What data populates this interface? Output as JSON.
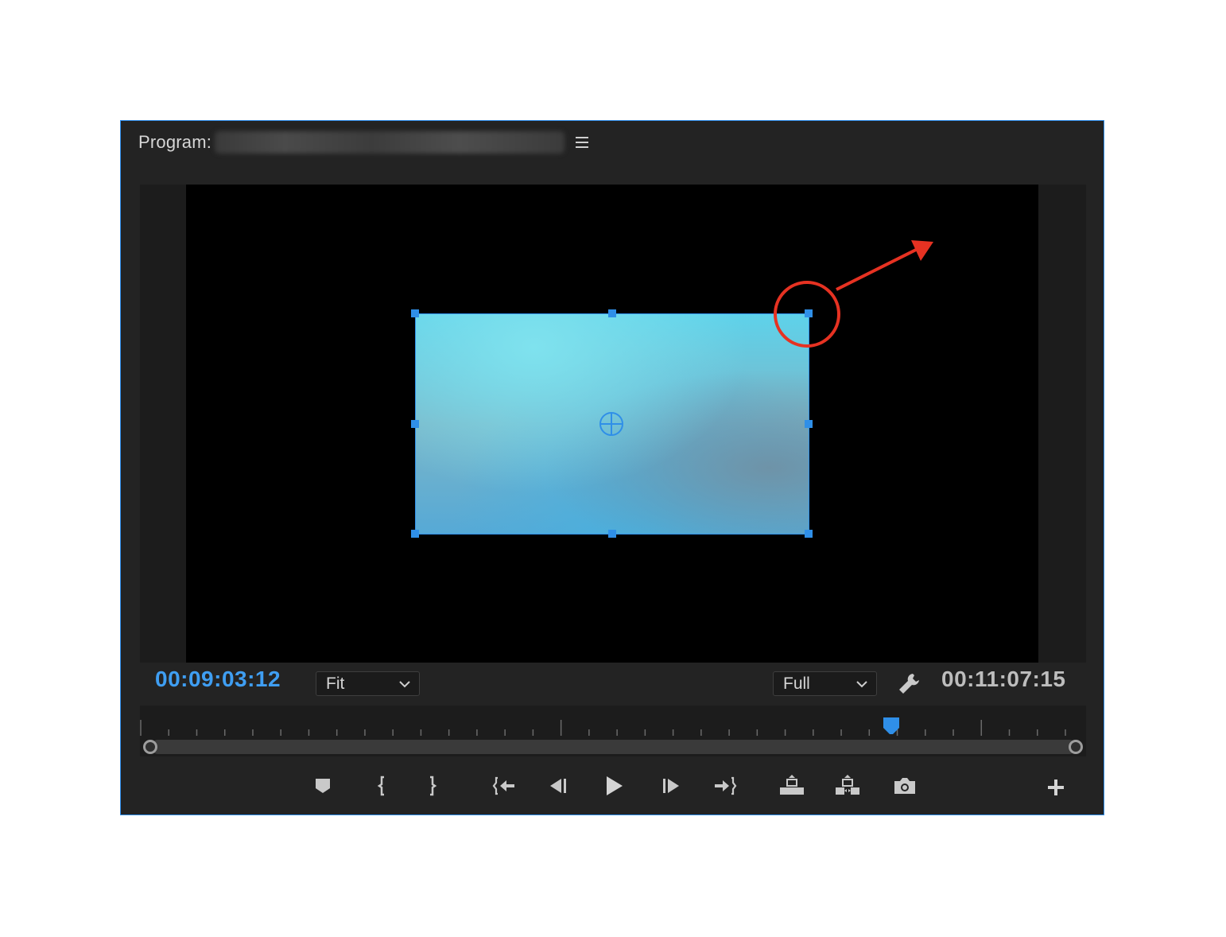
{
  "panel": {
    "title_label": "Program:",
    "sequence_name_redacted": true
  },
  "viewer": {
    "current_timecode": "00:09:03:12",
    "duration_timecode": "00:11:07:15",
    "zoom_select": {
      "value": "Fit"
    },
    "resolution_select": {
      "value": "Full"
    }
  },
  "timeline": {
    "playhead_position_fraction": 0.812
  },
  "transport_controls": [
    {
      "name": "add-marker-button",
      "icon": "marker-icon"
    },
    {
      "name": "mark-in-button",
      "icon": "mark-in-icon"
    },
    {
      "name": "mark-out-button",
      "icon": "mark-out-icon"
    },
    {
      "name": "go-to-in-button",
      "icon": "go-to-in-icon"
    },
    {
      "name": "step-back-button",
      "icon": "step-back-icon"
    },
    {
      "name": "play-button",
      "icon": "play-icon"
    },
    {
      "name": "step-forward-button",
      "icon": "step-forward-icon"
    },
    {
      "name": "go-to-out-button",
      "icon": "go-to-out-icon"
    },
    {
      "name": "lift-button",
      "icon": "lift-icon"
    },
    {
      "name": "extract-button",
      "icon": "extract-icon"
    },
    {
      "name": "export-frame-button",
      "icon": "camera-icon"
    },
    {
      "name": "button-editor-button",
      "icon": "plus-icon"
    }
  ],
  "colors": {
    "accent": "#2f8fe8",
    "timecode_current": "#3f9ef2",
    "annotation": "#e63222",
    "panel_bg": "#232323"
  }
}
